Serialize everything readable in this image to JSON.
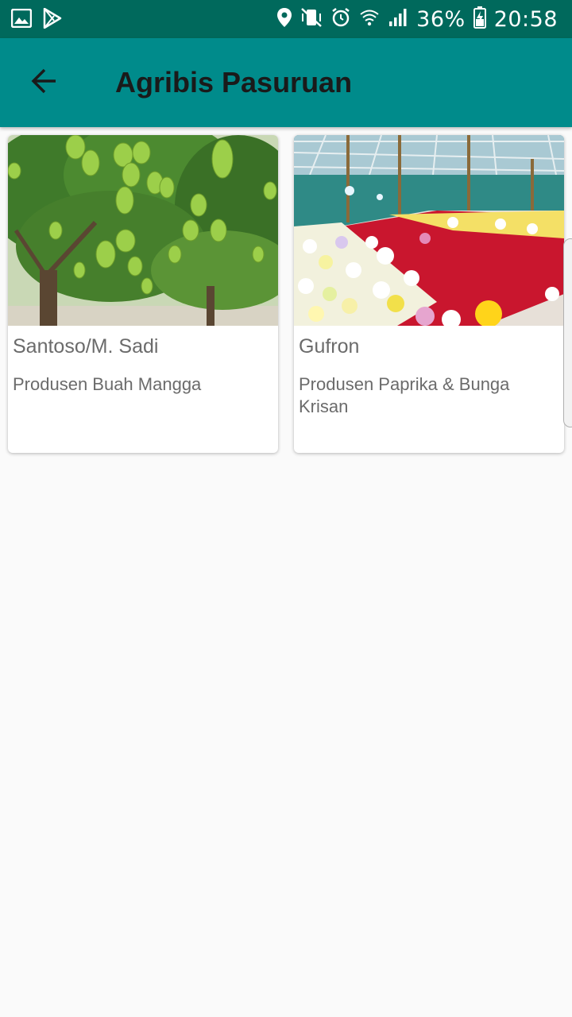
{
  "status_bar": {
    "battery": "36%",
    "time": "20:58",
    "left_icons": [
      "gallery-icon",
      "play-store-icon"
    ],
    "right_icons": [
      "location-icon",
      "vibrate-mute-icon",
      "alarm-icon",
      "wifi-icon",
      "signal-icon",
      "battery-charging-icon"
    ]
  },
  "app_bar": {
    "title": "Agribis Pasuruan",
    "back_icon": "arrow-back-icon",
    "color": "#008b8b"
  },
  "cards": [
    {
      "name": "Santoso/M. Sadi",
      "description": "Produsen Buah Mangga",
      "image": "mango-tree-photo"
    },
    {
      "name": "Gufron",
      "description": "Produsen Paprika & Bunga Krisan",
      "image": "flower-greenhouse-photo"
    }
  ]
}
